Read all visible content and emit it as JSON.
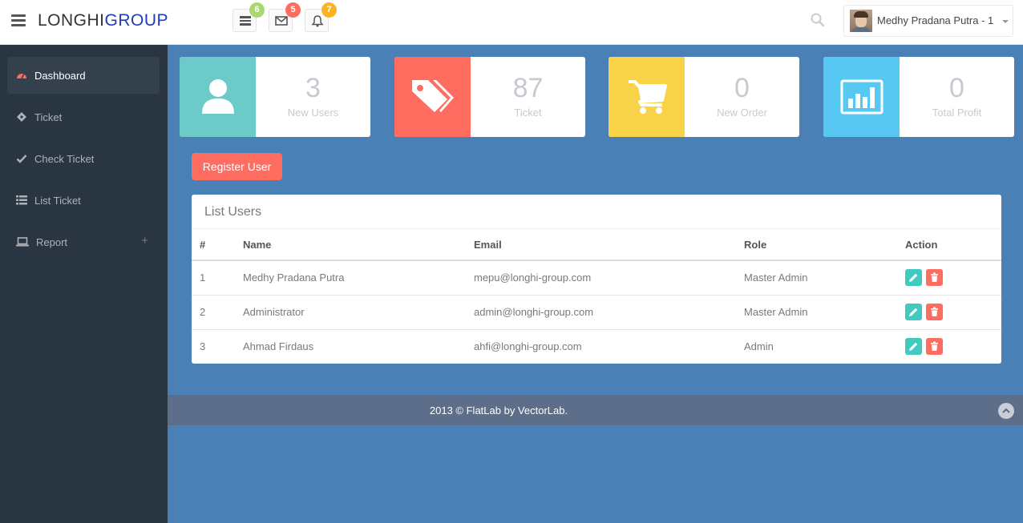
{
  "header": {
    "logo_main": "LONGHI",
    "logo_accent": "GROUP",
    "notifications": [
      {
        "icon": "tasks-icon",
        "count": "6",
        "color": "#a9d86e"
      },
      {
        "icon": "envelope-icon",
        "count": "5",
        "color": "#ff6c60"
      },
      {
        "icon": "bell-icon",
        "count": "7",
        "color": "#fcb322"
      }
    ],
    "user_name": "Medhy Pradana Putra - 1"
  },
  "sidebar": {
    "items": [
      {
        "label": "Dashboard",
        "icon": "dashboard-icon",
        "active": true
      },
      {
        "label": "Ticket",
        "icon": "ticket-icon"
      },
      {
        "label": "Check Ticket",
        "icon": "check-icon"
      },
      {
        "label": "List Ticket",
        "icon": "list-icon"
      },
      {
        "label": "Report",
        "icon": "laptop-icon",
        "expander": "+"
      }
    ]
  },
  "stats": [
    {
      "value": "3",
      "label": "New Users",
      "color": "#6ccac9",
      "icon": "user-icon"
    },
    {
      "value": "87",
      "label": "Ticket",
      "color": "#ff6c60",
      "icon": "tags-icon"
    },
    {
      "value": "0",
      "label": "New Order",
      "color": "#f8d347",
      "icon": "cart-icon"
    },
    {
      "value": "0",
      "label": "Total Profit",
      "color": "#57c8f2",
      "icon": "bar-chart-icon"
    }
  ],
  "register_button": "Register User",
  "users_panel": {
    "title": "List Users",
    "columns": [
      "#",
      "Name",
      "Email",
      "Role",
      "Action"
    ],
    "rows": [
      {
        "no": "1",
        "name": "Medhy Pradana Putra",
        "email": "mepu@longhi-group.com",
        "role": "Master Admin"
      },
      {
        "no": "2",
        "name": "Administrator",
        "email": "admin@longhi-group.com",
        "role": "Master Admin"
      },
      {
        "no": "3",
        "name": "Ahmad Firdaus",
        "email": "ahfi@longhi-group.com",
        "role": "Admin"
      }
    ]
  },
  "footer": {
    "text": "2013 © FlatLab by VectorLab."
  }
}
